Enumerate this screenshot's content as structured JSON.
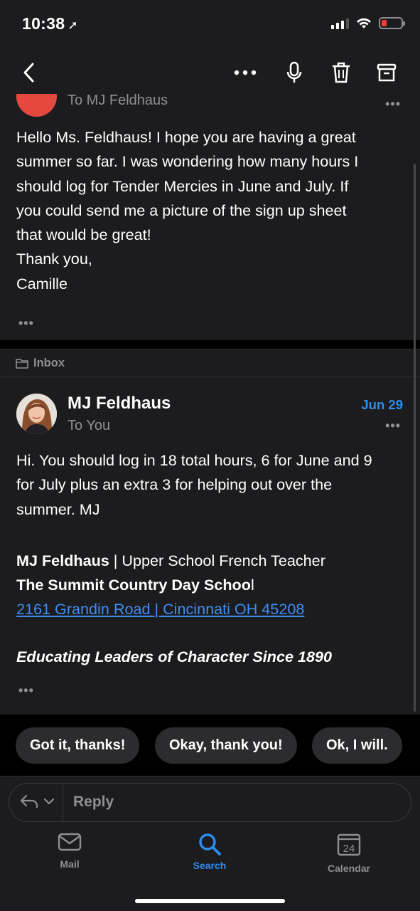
{
  "status_bar": {
    "time": "10:38",
    "location_icon": "location-arrow-icon",
    "battery_color": "#ff3b30"
  },
  "nav": {
    "icons": [
      "back-chevron-icon",
      "more-icon",
      "microphone-icon",
      "trash-icon",
      "archive-icon"
    ]
  },
  "message1": {
    "to_line": "To MJ Feldhaus",
    "more": "•••",
    "body_lines": [
      "Hello Ms. Feldhaus! I hope you are having a great",
      "summer so far. I was wondering how many hours I",
      "should log for Tender Mercies in June and July. If",
      "you could send me a picture of the sign up sheet",
      "that would be great!",
      "Thank you,",
      "Camille"
    ],
    "collapsed": "•••"
  },
  "folder": {
    "label": "Inbox"
  },
  "message2": {
    "sender": "MJ Feldhaus",
    "to_line": "To You",
    "date": "Jun 29",
    "more": "•••",
    "body_lines": [
      "Hi.  You should log in 18 total hours, 6 for June and 9",
      "for July plus an extra 3 for helping out over the",
      "summer.  MJ"
    ],
    "signature": {
      "name": "MJ Feldhaus",
      "title": " | Upper School French Teacher",
      "school_bold": "The Summit Country Day Schoo",
      "school_tail": "l",
      "address_link": "2161 Grandin Road | Cincinnati OH 45208",
      "motto": "Educating Leaders of Character Since 1890"
    },
    "collapsed": "•••"
  },
  "suggestions": [
    "Got it, thanks!",
    "Okay, thank you!",
    "Ok, I will."
  ],
  "reply": {
    "placeholder": "Reply"
  },
  "tabs": {
    "mail": "Mail",
    "search": "Search",
    "calendar": "Calendar",
    "calendar_day": "24"
  },
  "colors": {
    "accent": "#2d8ef0",
    "background": "#1c1c1e",
    "avatar_red": "#e5483f"
  }
}
